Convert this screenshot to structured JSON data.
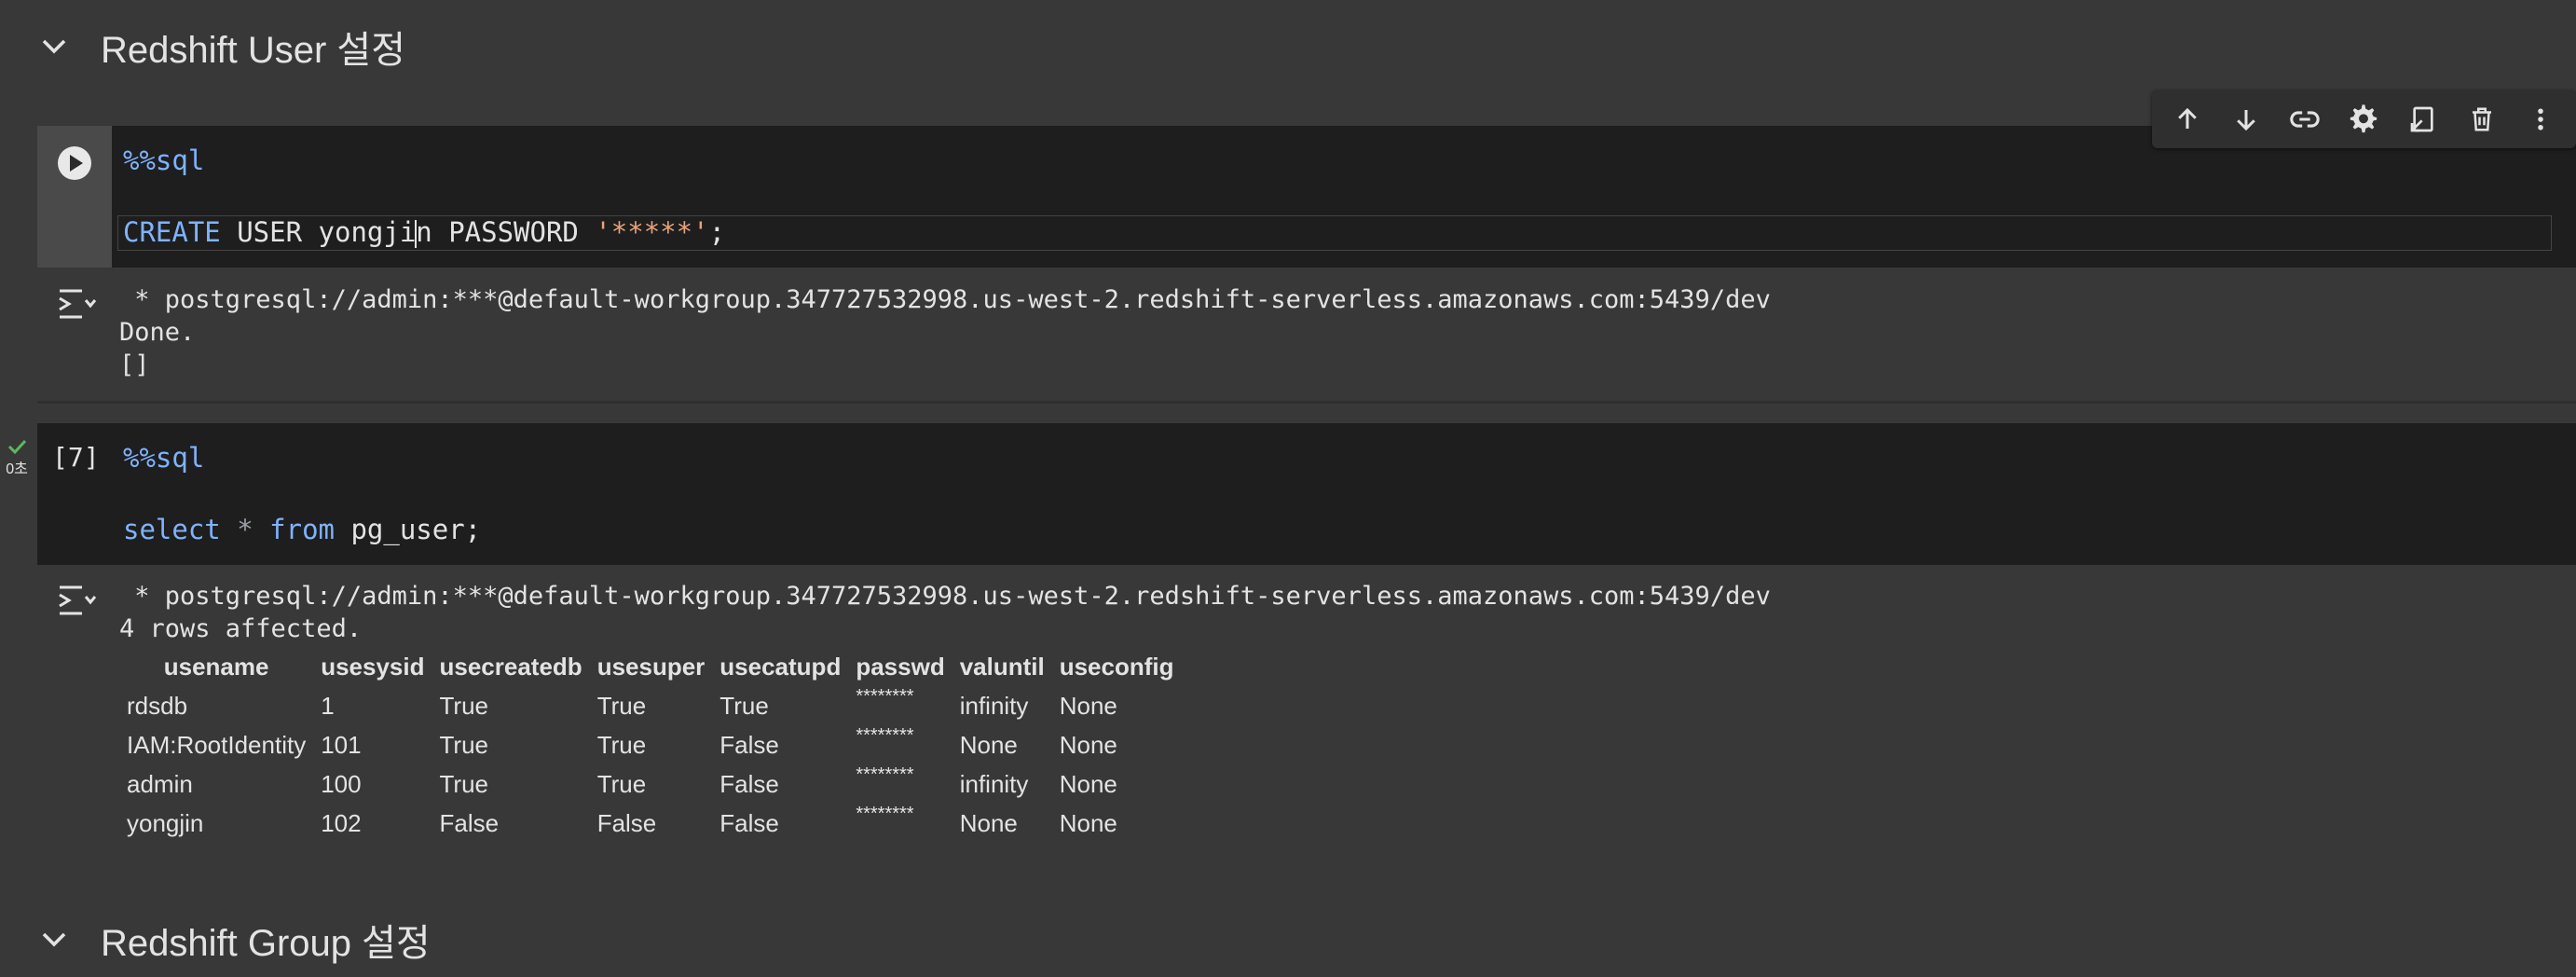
{
  "sections": {
    "user": {
      "title": "Redshift User 설정"
    },
    "group": {
      "title": "Redshift Group 설정"
    }
  },
  "cell1": {
    "line1": "%%sql",
    "line2_kw": "CREATE",
    "line2_a": " USER yongji",
    "line2_b": "n PASSWORD ",
    "line2_str": "'*****'",
    "line2_end": ";",
    "output_lines": [
      " * postgresql://admin:***@default-workgroup.347727532998.us-west-2.redshift-serverless.amazonaws.com:5439/dev",
      "Done.",
      "[]"
    ]
  },
  "cell2": {
    "exec_count": "[7]",
    "status_time": "0초",
    "line1": "%%sql",
    "line2_kw1": "select",
    "line2_star": " * ",
    "line2_kw2": "from",
    "line2_rest": " pg_user;",
    "output_lines": [
      " * postgresql://admin:***@default-workgroup.347727532998.us-west-2.redshift-serverless.amazonaws.com:5439/dev",
      "4 rows affected."
    ],
    "table": {
      "columns": [
        "usename",
        "usesysid",
        "usecreatedb",
        "usesuper",
        "usecatupd",
        "passwd",
        "valuntil",
        "useconfig"
      ],
      "rows": [
        [
          "rdsdb",
          "1",
          "True",
          "True",
          "True",
          "********",
          "infinity",
          "None"
        ],
        [
          "IAM:RootIdentity",
          "101",
          "True",
          "True",
          "False",
          "********",
          "None",
          "None"
        ],
        [
          "admin",
          "100",
          "True",
          "True",
          "False",
          "********",
          "infinity",
          "None"
        ],
        [
          "yongjin",
          "102",
          "False",
          "False",
          "False",
          "********",
          "None",
          "None"
        ]
      ]
    }
  },
  "toolbar": {
    "icons": [
      "arrow-up-icon",
      "arrow-down-icon",
      "link-icon",
      "gear-icon",
      "mirror-cell-icon",
      "delete-icon",
      "more-vert-icon"
    ]
  },
  "colors": {
    "background": "#383838",
    "code_bg": "#1e1e1e",
    "keyword": "#7fb3ff",
    "string": "#e8a27c",
    "check": "#5fb760"
  }
}
